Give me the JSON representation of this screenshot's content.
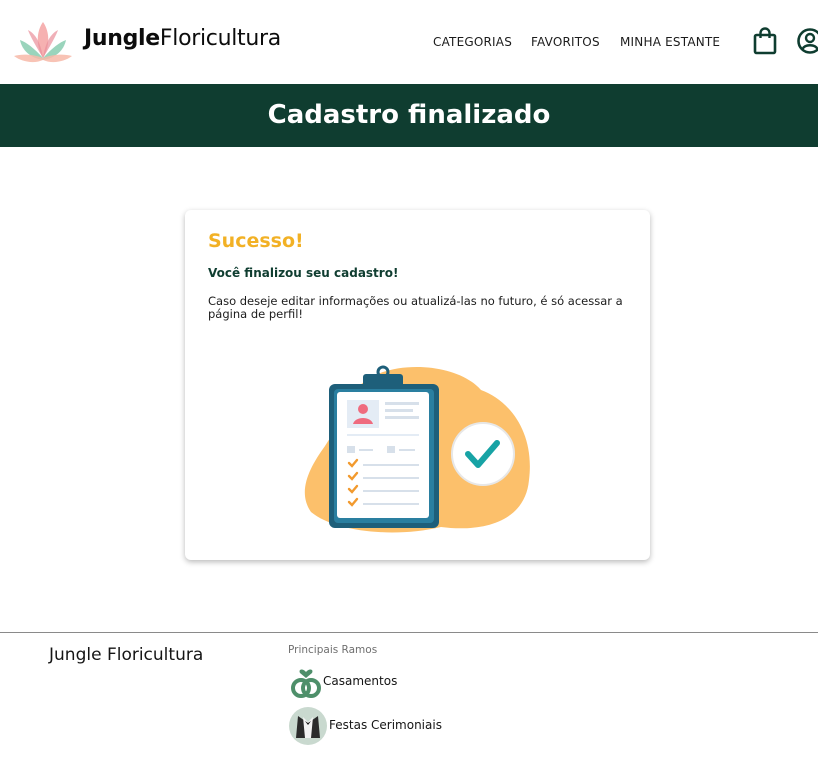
{
  "header": {
    "brand_bold": "Jungle",
    "brand_regular": "Floricultura",
    "nav": [
      "CATEGORIAS",
      "FAVORITOS",
      "MINHA ESTANTE"
    ],
    "icons": [
      "lotus-logo",
      "shopping-bag-icon",
      "user-circle-icon"
    ]
  },
  "banner": {
    "title": "Cadastro finalizado"
  },
  "card": {
    "title": "Sucesso!",
    "subtitle": "Você finalizou seu cadastro!",
    "text": "Caso deseje editar informações ou atualizá-las no futuro, é só acessar a página de perfil!"
  },
  "footer": {
    "brand": "Jungle Floricultura",
    "section_title": "Principais Ramos",
    "ramos": [
      "Casamentos",
      "Festas Cerimoniais"
    ]
  },
  "colors": {
    "banner": "#0f3d30",
    "accent_yellow": "#f2b125",
    "illustration_blob": "#fcc06b",
    "teal": "#17a3a5",
    "clipboard": "#1e5f7a"
  }
}
